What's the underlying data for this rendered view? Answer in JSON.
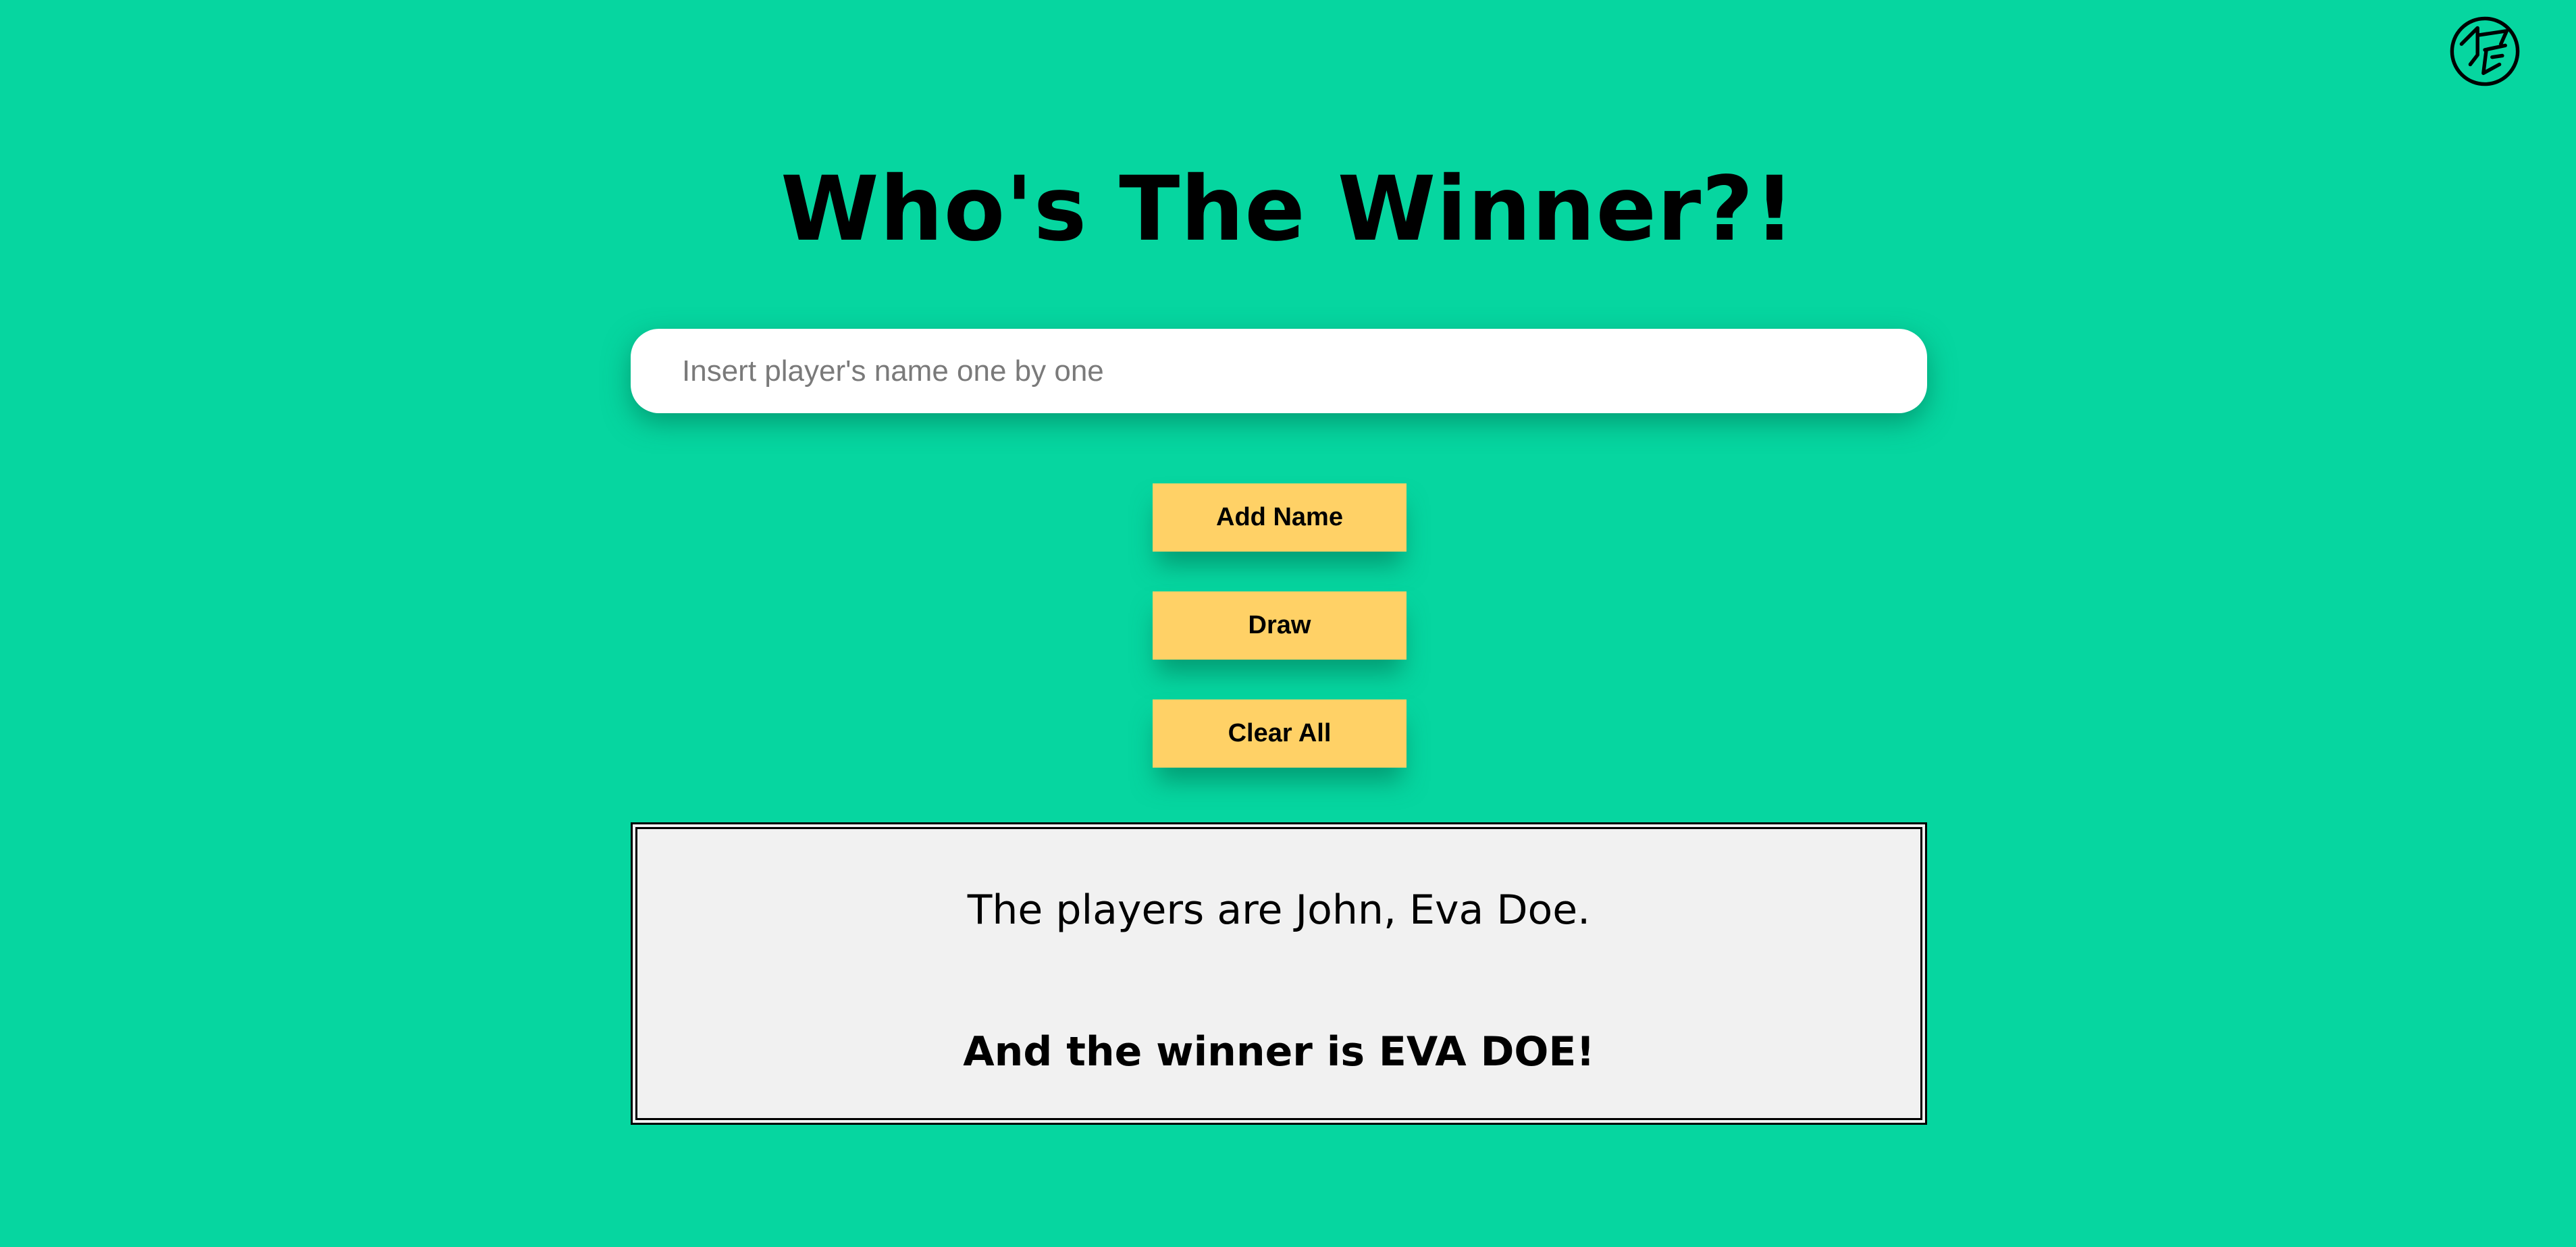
{
  "logo": {
    "icon": "brand-logo-icon"
  },
  "header": {
    "title": "Who's The Winner?!"
  },
  "form": {
    "input_placeholder": "Insert player's name one by one",
    "input_value": ""
  },
  "buttons": {
    "add_label": "Add Name",
    "draw_label": "Draw",
    "clear_label": "Clear All"
  },
  "result": {
    "players_text": "The players are John, Eva Doe.",
    "winner_text": "And the winner is EVA DOE!"
  },
  "colors": {
    "background": "#06D6A0",
    "button": "#FFD166",
    "result_background": "#F1F1F1",
    "text": "#000000"
  }
}
